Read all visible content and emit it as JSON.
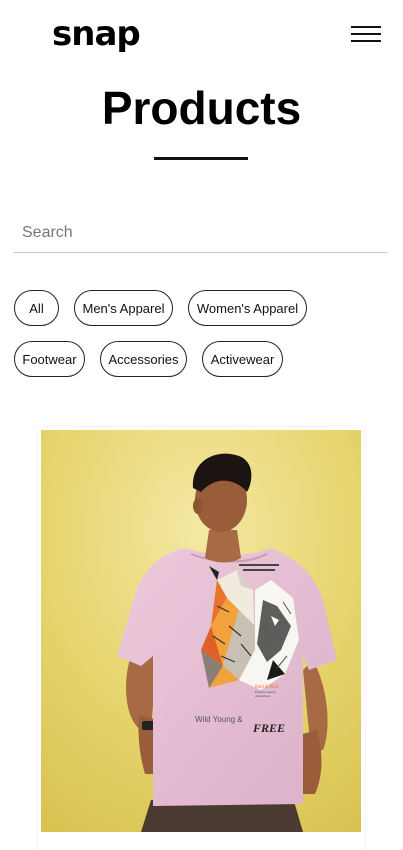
{
  "header": {
    "logo": "snap",
    "menu_icon": "hamburger-menu-icon"
  },
  "main": {
    "title": "Products",
    "search": {
      "placeholder": "Search",
      "value": ""
    },
    "filters": [
      {
        "label": "All"
      },
      {
        "label": "Men's Apparel"
      },
      {
        "label": "Women's Apparel"
      },
      {
        "label": "Footwear"
      },
      {
        "label": "Accessories"
      },
      {
        "label": "Activewear"
      }
    ],
    "product": {
      "shirt_text_1": "Wild Young &",
      "shirt_text_2": "FREE",
      "shirt_small_1": "Bold & Wild.",
      "shirt_small_2": "Explore every",
      "shirt_small_3": "adventure"
    }
  },
  "colors": {
    "background": "#ffffff",
    "text": "#000000",
    "photo_background": "#e6d46c",
    "tshirt": "#e8c3d6",
    "accent_orange": "#e8742c"
  }
}
